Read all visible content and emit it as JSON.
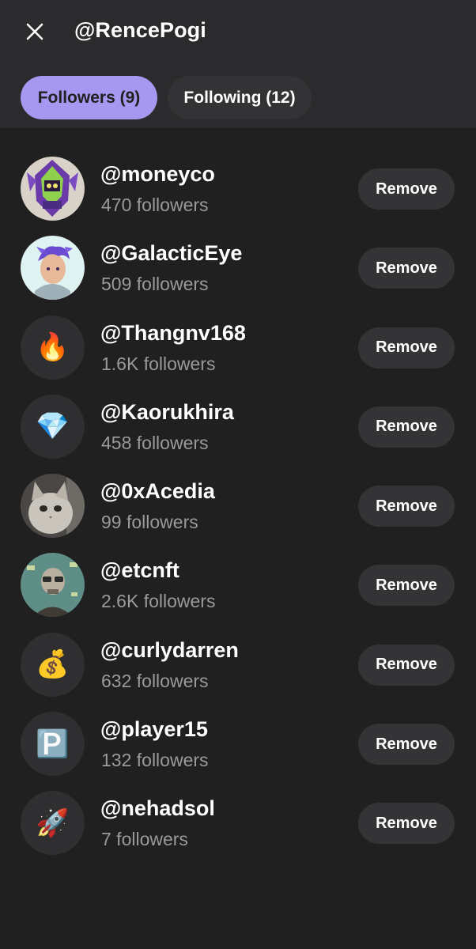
{
  "header": {
    "close_icon": "close-icon",
    "title": "@RencePogi"
  },
  "tabs": [
    {
      "label": "Followers (9)",
      "active": true
    },
    {
      "label": "Following (12)",
      "active": false
    }
  ],
  "colors": {
    "active_tab": "#a698f0",
    "background": "#202020",
    "header_bg": "#2b2b2d",
    "button_bg": "#343436",
    "muted_text": "#9a9a9e"
  },
  "followers": [
    {
      "username": "@moneyco",
      "followers": "470 followers",
      "avatar": "robot-avatar-image",
      "button": "Remove"
    },
    {
      "username": "@GalacticEye",
      "followers": "509 followers",
      "avatar": "anime-boy-avatar-image",
      "button": "Remove"
    },
    {
      "username": "@Thangnv168",
      "followers": "1.6K followers",
      "avatar": "🔥",
      "button": "Remove"
    },
    {
      "username": "@Kaorukhira",
      "followers": "458 followers",
      "avatar": "💎",
      "button": "Remove"
    },
    {
      "username": "@0xAcedia",
      "followers": "99 followers",
      "avatar": "cat-avatar-image",
      "button": "Remove"
    },
    {
      "username": "@etcnft",
      "followers": "2.6K followers",
      "avatar": "skeleton-avatar-image",
      "button": "Remove"
    },
    {
      "username": "@curlydarren",
      "followers": "632 followers",
      "avatar": "💰",
      "button": "Remove"
    },
    {
      "username": "@player15",
      "followers": "132 followers",
      "avatar": "🅿️",
      "button": "Remove"
    },
    {
      "username": "@nehadsol",
      "followers": "7 followers",
      "avatar": "🚀",
      "button": "Remove"
    }
  ]
}
